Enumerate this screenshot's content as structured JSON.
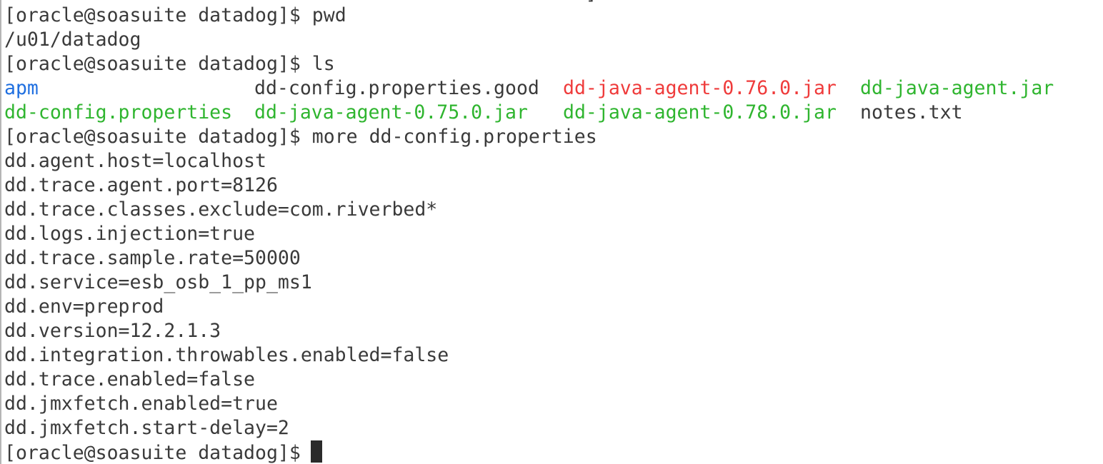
{
  "terminal": {
    "partial_top": "                                                   ]",
    "prompt": "[oracle@soasuite datadog]$",
    "cmd_pwd": "pwd",
    "pwd_output": "/u01/datadog",
    "cmd_ls": "ls",
    "ls_rows": [
      [
        {
          "text": "apm",
          "color": "#1f6fe0"
        },
        {
          "text": "dd-config.properties.good",
          "color": "#3a3a3a"
        },
        {
          "text": "dd-java-agent-0.76.0.jar",
          "color": "#ef3b3b"
        },
        {
          "text": "dd-java-agent.jar",
          "color": "#2fb52f"
        }
      ],
      [
        {
          "text": "dd-config.properties",
          "color": "#2fb52f"
        },
        {
          "text": "dd-java-agent-0.75.0.jar",
          "color": "#2fb52f"
        },
        {
          "text": "dd-java-agent-0.78.0.jar",
          "color": "#2fb52f"
        },
        {
          "text": "notes.txt",
          "color": "#3a3a3a"
        }
      ]
    ],
    "cmd_more": "more dd-config.properties",
    "properties": [
      "dd.agent.host=localhost",
      "dd.trace.agent.port=8126",
      "dd.trace.classes.exclude=com.riverbed*",
      "dd.logs.injection=true",
      "dd.trace.sample.rate=50000",
      "dd.service=esb_osb_1_pp_ms1",
      "dd.env=preprod",
      "dd.version=12.2.1.3",
      "dd.integration.throwables.enabled=false",
      "dd.trace.enabled=false",
      "dd.jmxfetch.enabled=true",
      "dd.jmxfetch.start-delay=2"
    ]
  }
}
